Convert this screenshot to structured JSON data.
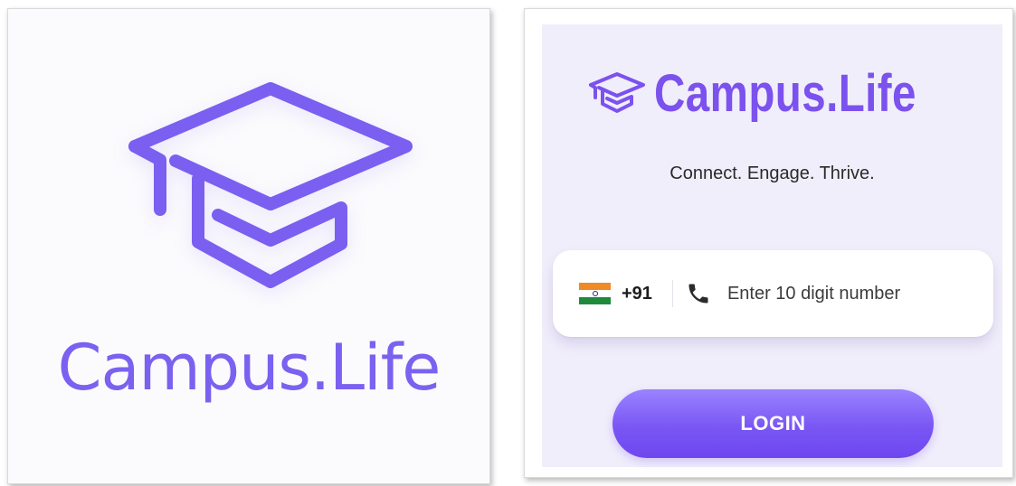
{
  "splash": {
    "logo_icon": "graduation-cap-icon",
    "title": "Campus.Life"
  },
  "login": {
    "brand_icon": "graduation-cap-icon",
    "brand_name": "Campus.Life",
    "tagline": "Connect. Engage. Thrive.",
    "country_flag": "india-flag-icon",
    "country_code": "+91",
    "phone_icon": "phone-icon",
    "phone_placeholder": "Enter 10 digit number",
    "phone_value": "",
    "login_label": "LOGIN"
  },
  "colors": {
    "brand_purple": "#7b52ee",
    "splash_purple": "#7b61f0",
    "login_bg": "#f1eefb",
    "button_gradient_top": "#9a83ff",
    "button_gradient_bottom": "#6e47ee"
  }
}
